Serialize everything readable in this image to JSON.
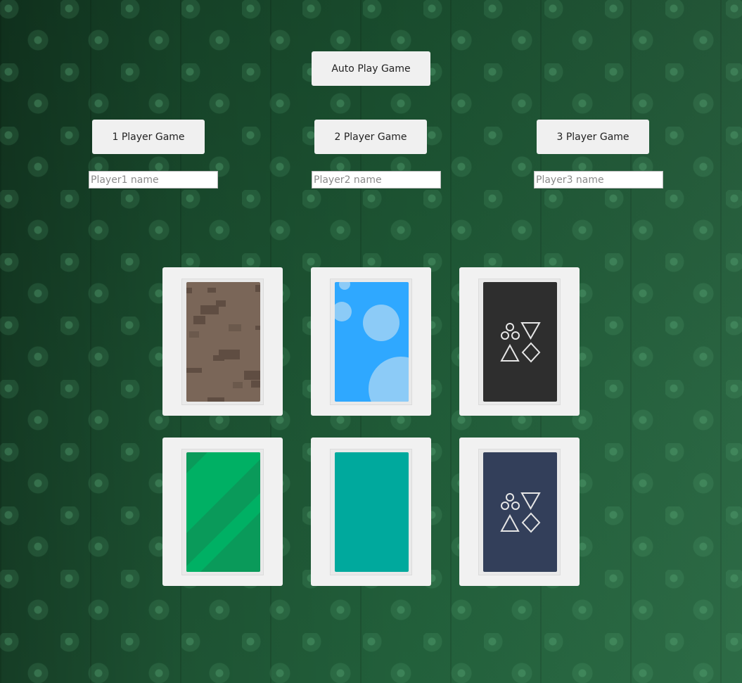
{
  "controls": {
    "auto_play_label": "Auto Play Game",
    "one_player_label": "1 Player Game",
    "two_player_label": "2 Player Game",
    "three_player_label": "3 Player Game"
  },
  "inputs": {
    "player1_placeholder": "Player1 name",
    "player1_value": "",
    "player2_placeholder": "Player2 name",
    "player2_value": "",
    "player3_placeholder": "Player3 name",
    "player3_value": ""
  },
  "card_backs": [
    {
      "style": "brown-bricks",
      "color": "#7a6658"
    },
    {
      "style": "blue-bubbles",
      "color": "#2fa8ff"
    },
    {
      "style": "dark-shapes",
      "color": "#2e2e2e"
    },
    {
      "style": "green-stripes",
      "color": "#0a9a5a"
    },
    {
      "style": "plain-teal",
      "color": "#00a99d"
    },
    {
      "style": "navy-shapes",
      "color": "#333f5a"
    }
  ],
  "colors": {
    "table_felt": "#1f5a36",
    "button_bg": "#f0f0f0",
    "card_slot_bg": "#f1f1f1"
  }
}
